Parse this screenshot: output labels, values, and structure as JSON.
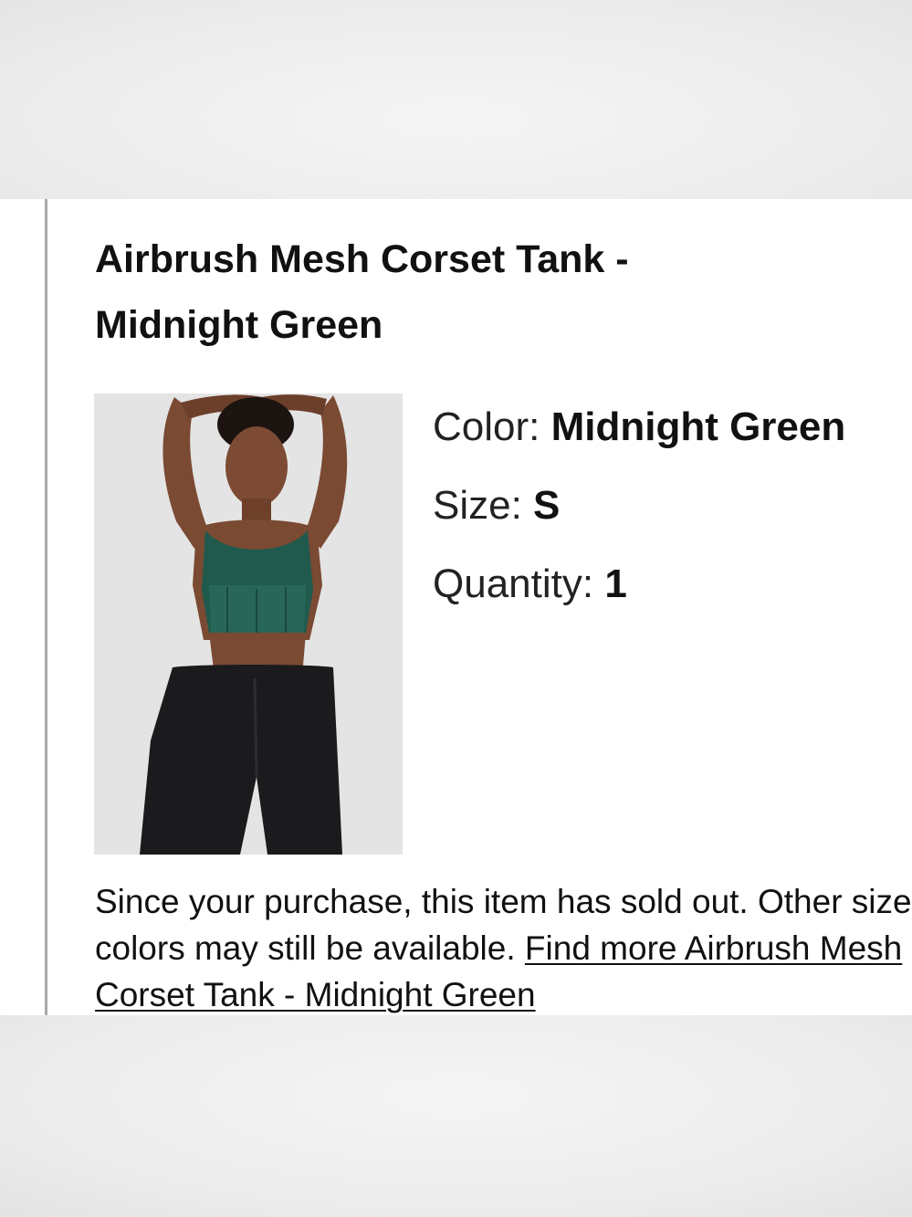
{
  "product": {
    "title": "Airbrush Mesh Corset Tank - Midnight Green",
    "image_alt": "Model wearing Airbrush Mesh Corset Tank in Midnight Green",
    "attributes": [
      {
        "label": "Color: ",
        "value": "Midnight Green"
      },
      {
        "label": "Size: ",
        "value": "S"
      },
      {
        "label": "Quantity: ",
        "value": "1"
      }
    ]
  },
  "notice": {
    "text": "Since your purchase, this item has sold out. Other sizes or colors may still be available. ",
    "link_text": "Find more Airbrush Mesh Corset Tank - Midnight Green"
  },
  "colors": {
    "card_background": "#ffffff",
    "page_background": "#f1f0f0",
    "divider": "#a9a9a9",
    "text": "#111111",
    "garment": "#1f5a4d"
  },
  "icons": [
    "product-photo"
  ]
}
